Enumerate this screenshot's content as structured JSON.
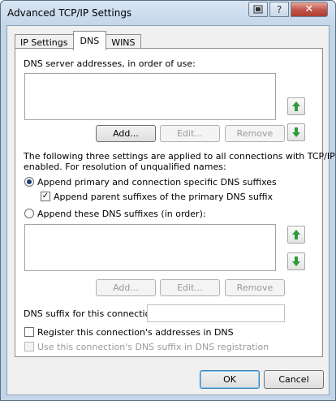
{
  "window": {
    "title": "Advanced TCP/IP Settings"
  },
  "titlebar": {
    "help_glyph": "?",
    "close_glyph": "✕"
  },
  "tabs": [
    {
      "label": "IP Settings"
    },
    {
      "label": "DNS"
    },
    {
      "label": "WINS"
    }
  ],
  "dns": {
    "servers_label": "DNS server addresses, in order of use:",
    "add_button": "Add...",
    "edit_button": "Edit...",
    "remove_button": "Remove",
    "settings_desc_line1": "The following three settings are applied to all connections with TCP/IP",
    "settings_desc_line2": "enabled. For resolution of unqualified names:",
    "radio_primary_label": "Append primary and connection specific DNS suffixes",
    "radio_primary_selected": true,
    "check_parent_label": "Append parent suffixes of the primary DNS suffix",
    "check_parent_checked": true,
    "radio_these_label": "Append these DNS suffixes (in order):",
    "radio_these_selected": false,
    "add_button2": "Add...",
    "edit_button2": "Edit...",
    "remove_button2": "Remove",
    "suffix_label": "DNS suffix for this connection:",
    "suffix_value": "",
    "register_label": "Register this connection's addresses in DNS",
    "register_checked": false,
    "use_suffix_label": "Use this connection's DNS suffix in DNS registration",
    "use_suffix_checked": false
  },
  "footer": {
    "ok_button": "OK",
    "cancel_button": "Cancel"
  },
  "colors": {
    "arrow_green": "#2e9a3a",
    "accent": "#3c7fb1"
  }
}
